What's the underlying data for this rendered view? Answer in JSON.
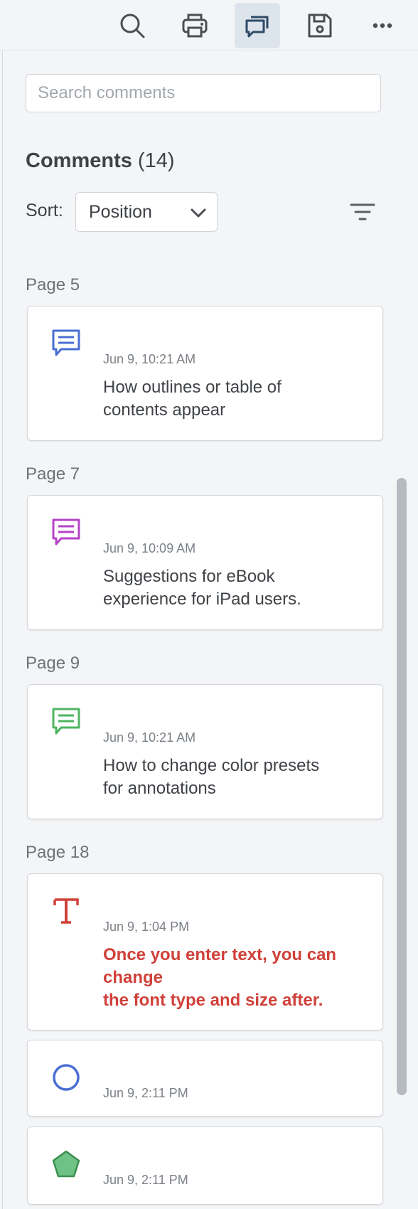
{
  "toolbar": {
    "buttons": [
      {
        "name": "search",
        "icon": "search-icon"
      },
      {
        "name": "print",
        "icon": "print-icon"
      },
      {
        "name": "comments",
        "icon": "comments-icon",
        "active": true
      },
      {
        "name": "save",
        "icon": "save-icon"
      },
      {
        "name": "more",
        "icon": "more-icon"
      }
    ]
  },
  "search": {
    "placeholder": "Search comments",
    "value": ""
  },
  "heading": {
    "title": "Comments",
    "count": "(14)"
  },
  "sort": {
    "label": "Sort:",
    "selected": "Position"
  },
  "groups": [
    {
      "page": "Page 5",
      "comments": [
        {
          "icon": "speech-bubble-icon",
          "color": "#4a6fd4",
          "date": "Jun 9, 10:21 AM",
          "text": "How outlines or table of\ncontents appear"
        }
      ]
    },
    {
      "page": "Page 7",
      "comments": [
        {
          "icon": "speech-bubble-icon",
          "color": "#b544c7",
          "date": "Jun 9, 10:09 AM",
          "text": "Suggestions for eBook\nexperience for iPad users."
        }
      ]
    },
    {
      "page": "Page 9",
      "comments": [
        {
          "icon": "speech-bubble-icon",
          "color": "#4fb55f",
          "date": "Jun 9, 10:21 AM",
          "text": "How to change color presets\nfor annotations"
        }
      ]
    },
    {
      "page": "Page 18",
      "comments": [
        {
          "icon": "text-t-icon",
          "color": "#d0413a",
          "date": "Jun 9, 1:04 PM",
          "text": "Once you enter text, you can\nchange\nthe font type and size after."
        },
        {
          "icon": "circle-icon",
          "color": "#4a6fd4",
          "date": "Jun 9, 2:11 PM",
          "text": ""
        },
        {
          "icon": "pentagon-icon",
          "color": "#3a8f4f",
          "date": "Jun 9, 2:11 PM",
          "text": ""
        }
      ]
    }
  ]
}
